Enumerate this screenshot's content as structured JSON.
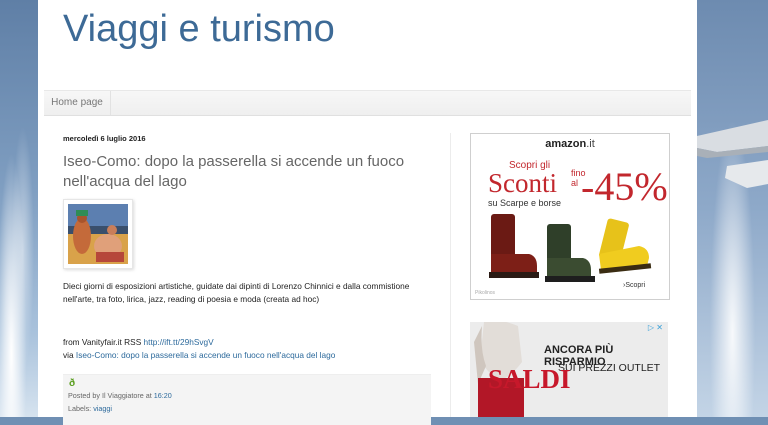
{
  "blog": {
    "title": "Viaggi e turismo"
  },
  "nav": {
    "tabs": [
      {
        "label": "Home page"
      }
    ]
  },
  "post": {
    "date": "mercoledì 6 luglio 2016",
    "title": "Iseo-Como: dopo la passerella si accende un fuoco nell'acqua del lago",
    "body": "Dieci giorni di esposizioni artistiche, guidate dai dipinti di Lorenzo Chinnici e dalla commistione nell'arte, tra foto, lirica, jazz, reading di poesia e moda (creata ad hoc)",
    "source_prefix": "from Vanityfair.it RSS",
    "source_link": "http://ift.tt/29hSvgV",
    "via_prefix": "via",
    "via_link": "Iseo-Como: dopo la passerella si accende un fuoco nell'acqua del lago",
    "footer": {
      "posted_by_prefix": "Posted by",
      "author": "Il Viaggiatore",
      "at": "at",
      "time": "16:20",
      "labels_prefix": "Labels:",
      "label": "viaggi"
    }
  },
  "ads": {
    "ad1": {
      "brand": "amazon",
      "brand_tld": ".it",
      "line1": "Scopri gli",
      "big_word": "Sconti",
      "fino": "fino",
      "al": "al",
      "percent": "-45%",
      "subline": "su Scarpe e borse",
      "cta": "›Scopri",
      "tiny": "Pikolinos"
    },
    "ad2": {
      "adchoices": "▷ ✕",
      "headline": "ANCORA PIÙ RISPARMIO",
      "subhead": "SUI PREZZI OUTLET",
      "saldi": "SALDI"
    }
  },
  "colors": {
    "title": "#3d6a96",
    "link": "#2d6a9c",
    "ad_red": "#c2272d",
    "saldi_red": "#c7182b"
  }
}
